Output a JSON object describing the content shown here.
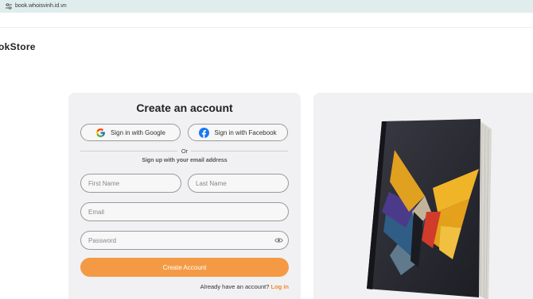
{
  "browser": {
    "url": "book.whoisvinh.id.vn"
  },
  "header": {
    "logo_text": "okStore"
  },
  "signup": {
    "title": "Create an account",
    "google_label": "Sign in with Google",
    "facebook_label": "Sign in with Facebook",
    "or_text": "Or",
    "email_subtext": "Sign up with your email address",
    "first_name_placeholder": "First Name",
    "last_name_placeholder": "Last Name",
    "email_placeholder": "Email",
    "password_placeholder": "Password",
    "create_button_label": "Create Account",
    "login_prompt": "Already have an account?",
    "login_link_label": "Log in"
  },
  "icons": {
    "url_icon": "tune-icon",
    "google": "google-icon",
    "facebook": "facebook-icon",
    "password_toggle": "eye-icon"
  },
  "colors": {
    "accent": "#f49a45",
    "link": "#f08a2a",
    "facebook": "#1877f2",
    "url_bar": "#dfeeec",
    "card": "#f1f1f4"
  }
}
